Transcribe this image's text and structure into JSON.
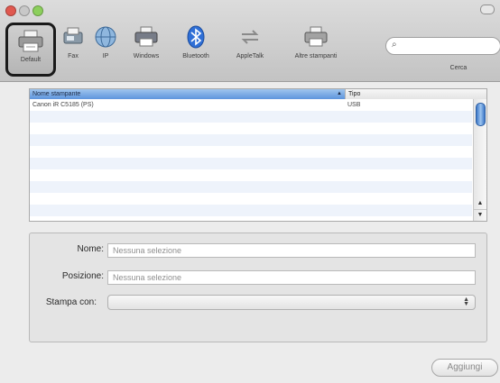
{
  "toolbar": {
    "items": [
      {
        "label": "Default",
        "icon": "printer-icon"
      },
      {
        "label": "Fax",
        "icon": "fax-icon"
      },
      {
        "label": "IP",
        "icon": "globe-icon"
      },
      {
        "label": "Windows",
        "icon": "windows-printer-icon"
      },
      {
        "label": "Bluetooth",
        "icon": "bluetooth-icon"
      },
      {
        "label": "AppleTalk",
        "icon": "appletalk-icon"
      },
      {
        "label": "Altre stampanti",
        "icon": "printer-icon"
      }
    ],
    "search_label": "Cerca",
    "search_value": ""
  },
  "list": {
    "headers": {
      "name": "Nome stampante",
      "type": "Tipo"
    },
    "rows": [
      {
        "name": "Canon iR C5185 (PS)",
        "type": "USB"
      }
    ]
  },
  "details": {
    "name_label": "Nome:",
    "name_placeholder": "Nessuna selezione",
    "location_label": "Posizione:",
    "location_placeholder": "Nessuna selezione",
    "print_with_label": "Stampa con:",
    "print_with_value": ""
  },
  "add_button": "Aggiungi",
  "colors": {
    "selection": "#5d95dd",
    "bluetooth": "#2f6fd6"
  }
}
